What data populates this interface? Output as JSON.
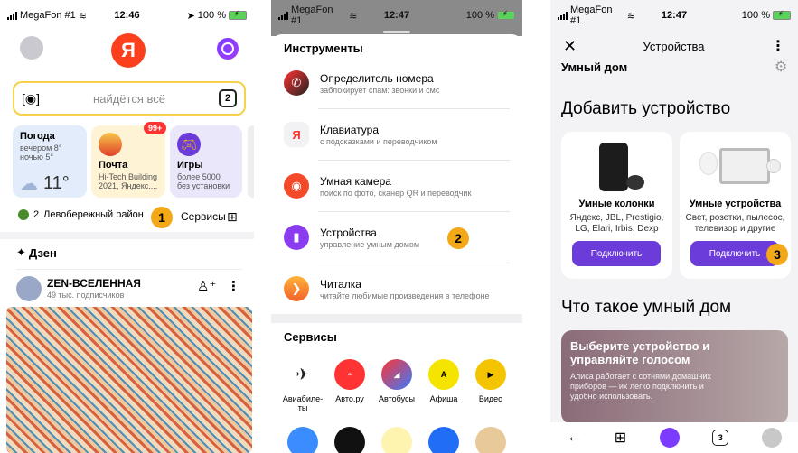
{
  "screen1": {
    "status": {
      "carrier": "MegaFon #1",
      "time": "12:46",
      "battery": "100 %"
    },
    "search_placeholder": "найдётся всё",
    "tabs_count": "2",
    "weather": {
      "title": "Погода",
      "evening": "вечером 8°",
      "night": "ночью 5°",
      "temp": "11°"
    },
    "mail": {
      "title": "Почта",
      "badge": "99+",
      "preview": "Hi-Tech Building 2021, Яндекс...."
    },
    "games": {
      "title": "Игры",
      "sub": "более 5000 без установки"
    },
    "location": {
      "count": "2",
      "district": "Левобережный район"
    },
    "services_label": "Сервисы",
    "step": "1",
    "dzen": {
      "label": "Дзен",
      "channel": "ZEN-ВСЕЛЕННАЯ",
      "subscribers": "49 тыс. подписчиков"
    }
  },
  "screen2": {
    "status": {
      "carrier": "MegaFon #1",
      "time": "12:47",
      "battery": "100 %"
    },
    "section_tools": "Инструменты",
    "tools": [
      {
        "title": "Определитель номера",
        "sub": "заблокирует спам: звонки и смс"
      },
      {
        "title": "Клавиатура",
        "sub": "с подсказками и переводчиком"
      },
      {
        "title": "Умная камера",
        "sub": "поиск по фото, сканер QR и переводчик"
      },
      {
        "title": "Устройства",
        "sub": "управление умным домом"
      },
      {
        "title": "Читалка",
        "sub": "читайте любимые произведения в телефоне"
      }
    ],
    "step": "2",
    "section_services": "Сервисы",
    "services": [
      "Авиабиле-ты",
      "Авто.ру",
      "Автобусы",
      "Афиша",
      "Видео"
    ]
  },
  "screen3": {
    "status": {
      "carrier": "MegaFon #1",
      "time": "12:47",
      "battery": "100 %"
    },
    "header_title": "Устройства",
    "smart_home": "Умный дом",
    "add_device": "Добавить устройство",
    "speakers": {
      "title": "Умные колонки",
      "sub": "Яндекс, JBL, Prestigio, LG, Elari, Irbis, Dexp",
      "button": "Подключить"
    },
    "devices": {
      "title": "Умные устройства",
      "sub": "Свет, розетки, пылесос, телевизор и другие",
      "button": "Подключить"
    },
    "step": "3",
    "what_is": "Что такое умный дом",
    "promo": {
      "title": "Выберите устройство и управляйте голосом",
      "text": "Алиса работает с сотнями домашних приборов — их легко подключить и удобно использовать."
    },
    "tabs_count": "3"
  }
}
